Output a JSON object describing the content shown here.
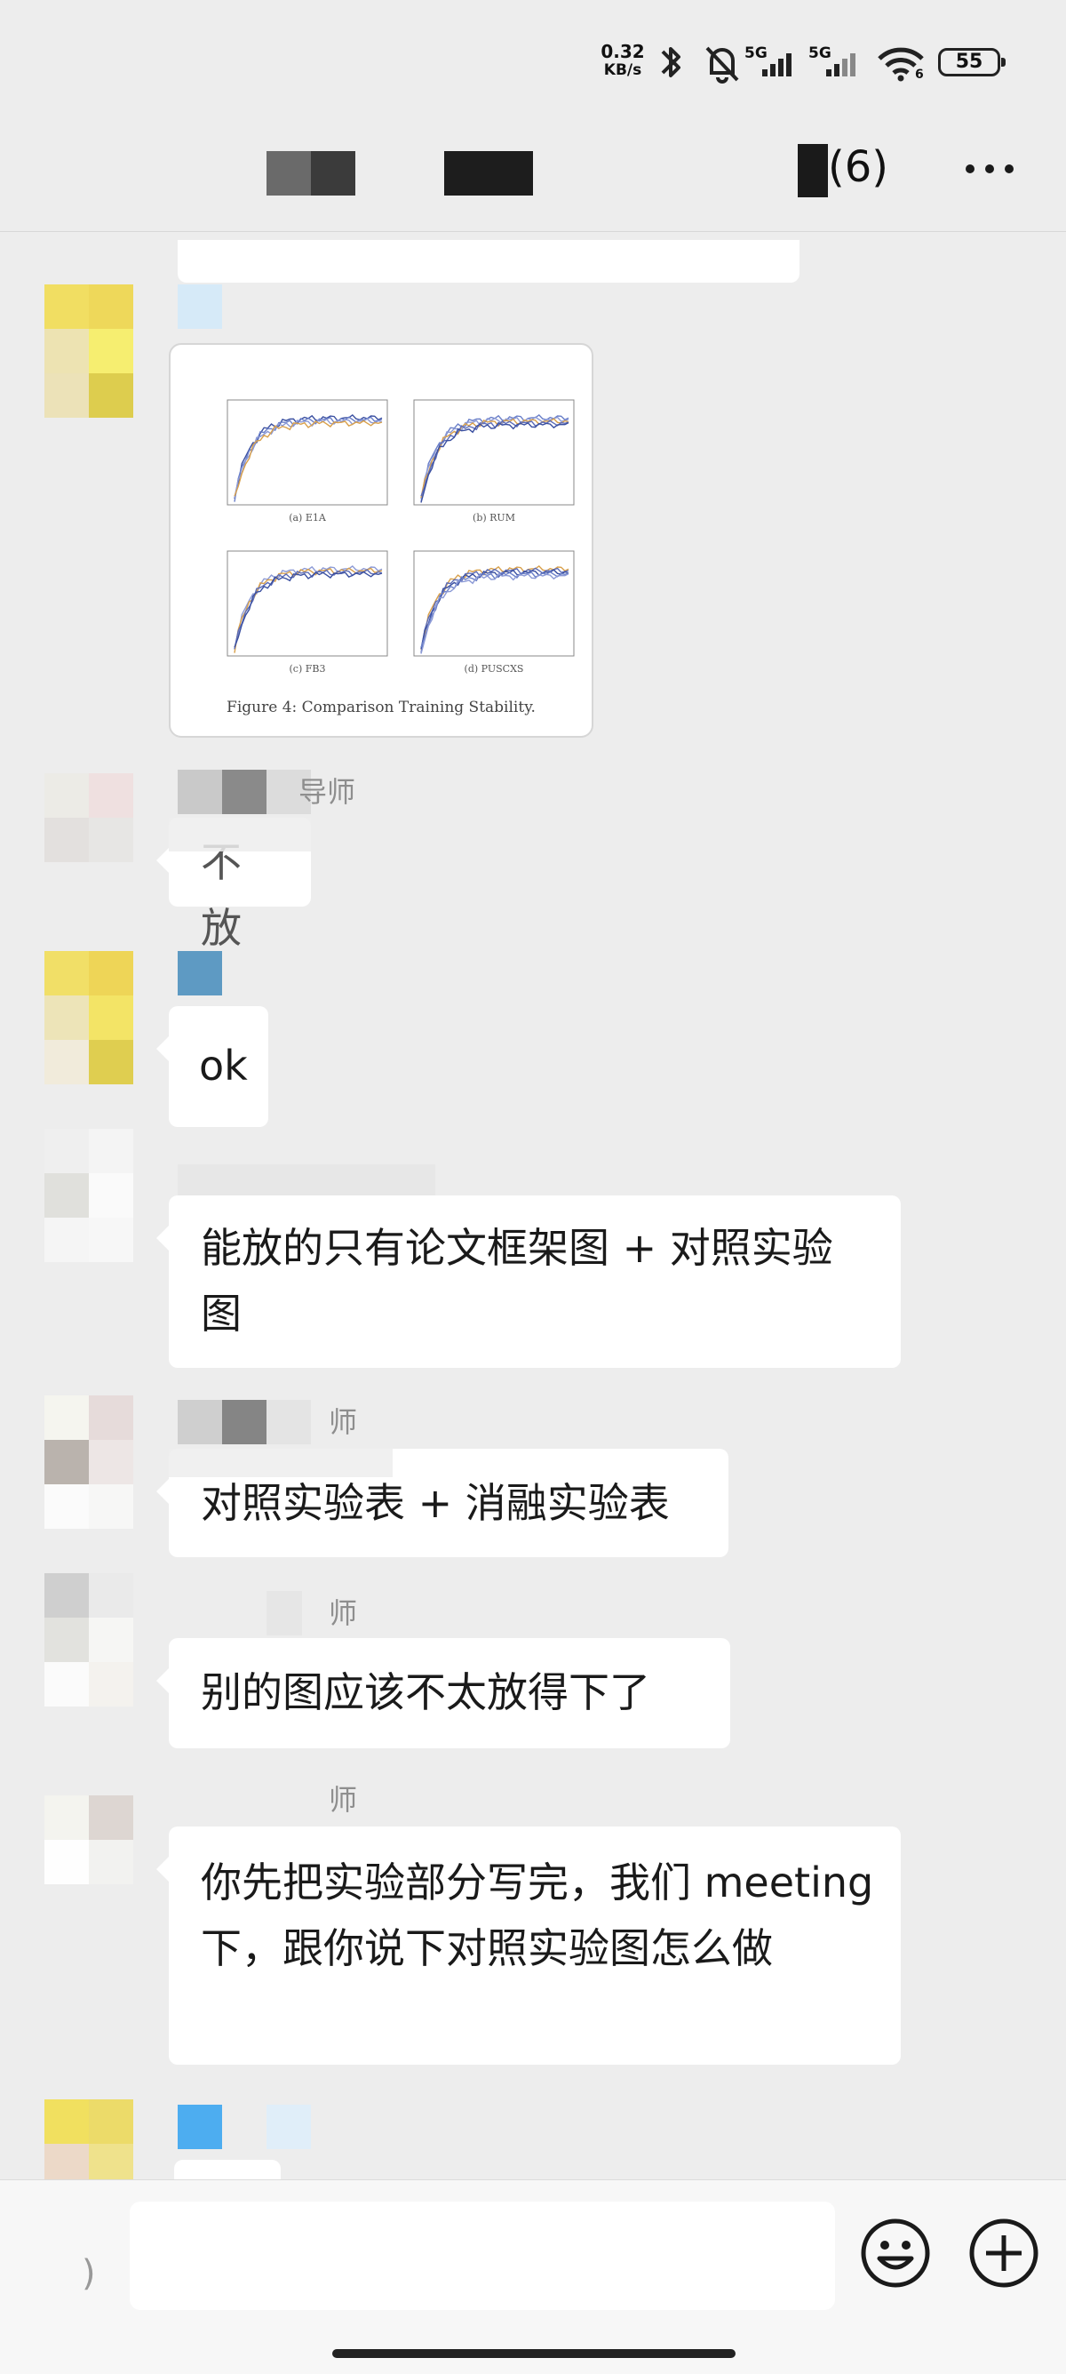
{
  "status_bar": {
    "speed_value": "0.32",
    "speed_unit": "KB/s",
    "network_1": "5G",
    "network_2": "5G",
    "wifi_label": "6",
    "battery": "55"
  },
  "header": {
    "title_count": "(6)",
    "more_icon": "more-dots-icon"
  },
  "messages": [
    {
      "type": "image",
      "figure_caption": "Figure 4: Comparison Training Stability.",
      "panel_labels": [
        "(a) E1A",
        "(b) RUM",
        "(c) FB3",
        "(d) PUSCXS"
      ]
    },
    {
      "type": "text",
      "sender_tail": "导师",
      "text": "不放"
    },
    {
      "type": "text",
      "sender_tail": "",
      "text": "ok"
    },
    {
      "type": "text",
      "sender_tail": "",
      "text": "能放的只有论文框架图 + 对照实验图"
    },
    {
      "type": "text",
      "sender_tail": "师",
      "text": "对照实验表 + 消融实验表"
    },
    {
      "type": "text",
      "sender_tail": "师",
      "text": "别的图应该不太放得下了"
    },
    {
      "type": "text",
      "sender_tail": "师",
      "text": "你先把实验部分写完，我们 meeting 下，跟你说下对照实验图怎么做"
    }
  ],
  "input_bar": {
    "input_value": "",
    "emoji_icon": "emoji-icon",
    "plus_icon": "plus-circle-icon"
  }
}
